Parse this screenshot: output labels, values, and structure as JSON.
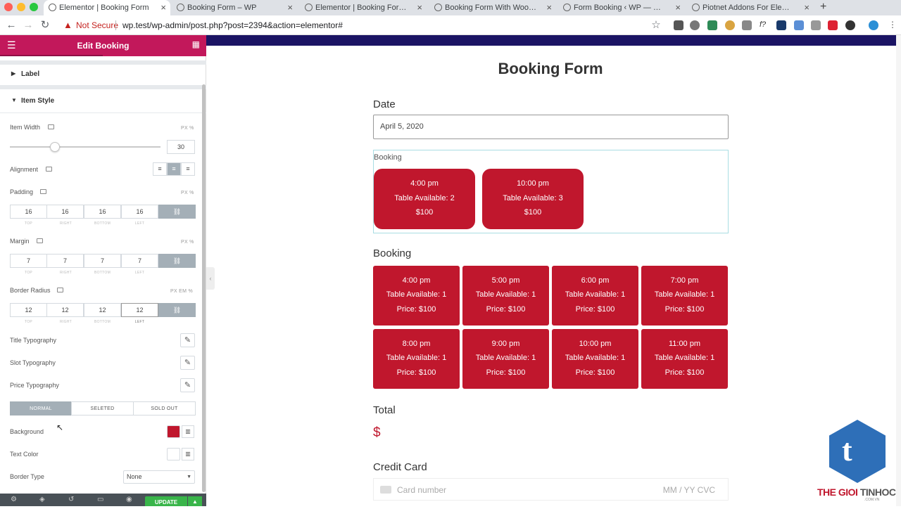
{
  "browser": {
    "tabs": [
      {
        "title": "Elementor | Booking Form",
        "active": true
      },
      {
        "title": "Booking Form – WP",
        "active": false
      },
      {
        "title": "Elementor | Booking Form With W",
        "active": false
      },
      {
        "title": "Booking Form With Woocommerce",
        "active": false
      },
      {
        "title": "Form Booking ‹ WP — WordPress",
        "active": false
      },
      {
        "title": "Piotnet Addons For Elementor (P",
        "active": false
      }
    ],
    "new_tab": "+",
    "not_secure": "Not Secure",
    "url": "wp.test/wp-admin/post.php?post=2394&action=elementor#"
  },
  "panel": {
    "header_title": "Edit Booking",
    "sections": {
      "label": "Label",
      "item_style": "Item Style"
    },
    "item_width": {
      "label": "Item Width",
      "units": "PX %",
      "value": "30",
      "slider_fraction": 0.3
    },
    "alignment": {
      "label": "Alignment",
      "selected": "center"
    },
    "padding": {
      "label": "Padding",
      "units": "PX %",
      "top": "16",
      "right": "16",
      "bottom": "16",
      "left": "16"
    },
    "margin": {
      "label": "Margin",
      "units": "PX %",
      "top": "7",
      "right": "7",
      "bottom": "7",
      "left": "7"
    },
    "border_radius": {
      "label": "Border Radius",
      "units": "PX EM %",
      "top": "12",
      "right": "12",
      "bottom": "12",
      "left": "12"
    },
    "dim_labels": {
      "top": "TOP",
      "right": "RIGHT",
      "bottom": "BOTTOM",
      "left": "LEFT"
    },
    "title_typography": "Title Typography",
    "slot_typography": "Slot Typography",
    "price_typography": "Price Typography",
    "state_tabs": [
      "NORMAL",
      "SELETED",
      "SOLD OUT"
    ],
    "active_state": "NORMAL",
    "background": {
      "label": "Background",
      "color": "#c0172d"
    },
    "text_color": {
      "label": "Text Color",
      "color": "#ffffff"
    },
    "border_type": {
      "label": "Border Type",
      "value": "None"
    },
    "update_label": "UPDATE"
  },
  "preview": {
    "form_title": "Booking Form",
    "date": {
      "label": "Date",
      "value": "April 5, 2020"
    },
    "booking_small": {
      "label": "Booking",
      "slots": [
        {
          "time": "4:00 pm",
          "avail": "Table Available: 2",
          "price": "$100"
        },
        {
          "time": "10:00 pm",
          "avail": "Table Available: 3",
          "price": "$100"
        }
      ]
    },
    "booking_grid": {
      "label": "Booking",
      "slots": [
        {
          "time": "4:00 pm",
          "avail": "Table Available: 1",
          "price": "Price: $100"
        },
        {
          "time": "5:00 pm",
          "avail": "Table Available: 1",
          "price": "Price: $100"
        },
        {
          "time": "6:00 pm",
          "avail": "Table Available: 1",
          "price": "Price: $100"
        },
        {
          "time": "7:00 pm",
          "avail": "Table Available: 1",
          "price": "Price: $100"
        },
        {
          "time": "8:00 pm",
          "avail": "Table Available: 1",
          "price": "Price: $100"
        },
        {
          "time": "9:00 pm",
          "avail": "Table Available: 1",
          "price": "Price: $100"
        },
        {
          "time": "10:00 pm",
          "avail": "Table Available: 1",
          "price": "Price: $100"
        },
        {
          "time": "11:00 pm",
          "avail": "Table Available: 1",
          "price": "Price: $100"
        }
      ]
    },
    "total": {
      "label": "Total",
      "value": "$"
    },
    "credit_card": {
      "label": "Credit Card",
      "placeholder": "Card number",
      "exp": "MM / YY  CVC"
    }
  },
  "watermark": {
    "brand_part1": "THE GIOI",
    "brand_part2": "TINHOC",
    "domain": ".COM.VN",
    "letter": "t"
  },
  "colors": {
    "accent": "#c2185b",
    "slot": "#c0172d",
    "update": "#39b54a"
  }
}
